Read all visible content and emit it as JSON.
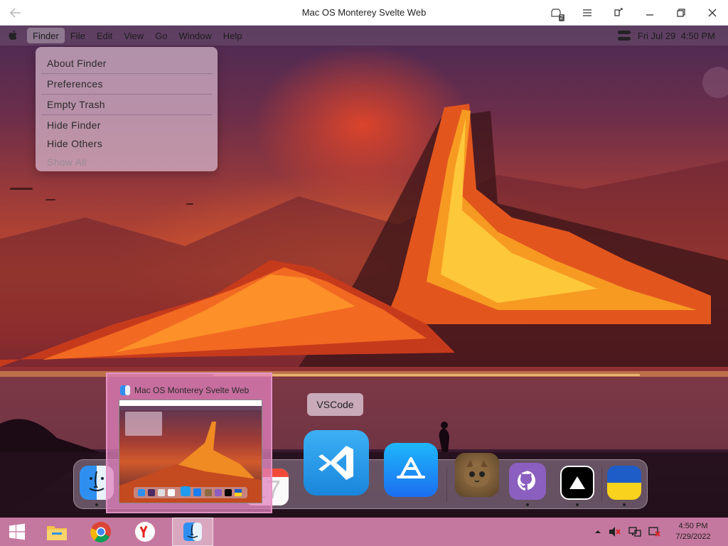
{
  "window": {
    "title": "Mac OS Monterey Svelte Web",
    "tab_count": "2"
  },
  "menubar": {
    "items": [
      "Finder",
      "File",
      "Edit",
      "View",
      "Go",
      "Window",
      "Help"
    ],
    "active_item": "Finder",
    "datetime": "Fri Jul 29  4:50 PM"
  },
  "finder_menu": {
    "items": [
      {
        "label": "About Finder",
        "enabled": true
      },
      {
        "label": "Preferences",
        "enabled": true
      },
      {
        "label": "Empty Trash",
        "enabled": true
      },
      {
        "label": "Hide Finder",
        "enabled": true
      },
      {
        "label": "Hide Others",
        "enabled": true
      },
      {
        "label": "Show All",
        "enabled": false
      }
    ]
  },
  "dock": {
    "tooltip": "VSCode",
    "apps": [
      {
        "name": "Finder",
        "icon": "finder-icon",
        "running": true
      },
      {
        "name": "Calendar",
        "icon": "calendar-icon",
        "running": false,
        "day": "17"
      },
      {
        "name": "VSCode",
        "icon": "vscode-icon",
        "running": false
      },
      {
        "name": "App Store",
        "icon": "app-store-icon",
        "running": false
      },
      {
        "name": "Cat",
        "icon": "cat-photo-icon",
        "running": false
      },
      {
        "name": "GitHub",
        "icon": "github-icon",
        "running": true
      },
      {
        "name": "Vercel",
        "icon": "vercel-icon",
        "running": true
      },
      {
        "name": "Ukraine",
        "icon": "ukraine-flag-icon",
        "running": true
      }
    ]
  },
  "preview": {
    "title": "Mac OS Monterey Svelte Web"
  },
  "taskbar": {
    "apps": [
      "start-icon",
      "file-explorer-icon",
      "chrome-icon",
      "yandex-icon",
      "finder-icon"
    ],
    "time": "4:50 PM",
    "date": "7/29/2022"
  },
  "colors": {
    "taskbar": "#c5789f",
    "vscode_blue": "#1f9cf0",
    "ukraine_blue": "#1e5cc8",
    "ukraine_yellow": "#f8d21c"
  }
}
